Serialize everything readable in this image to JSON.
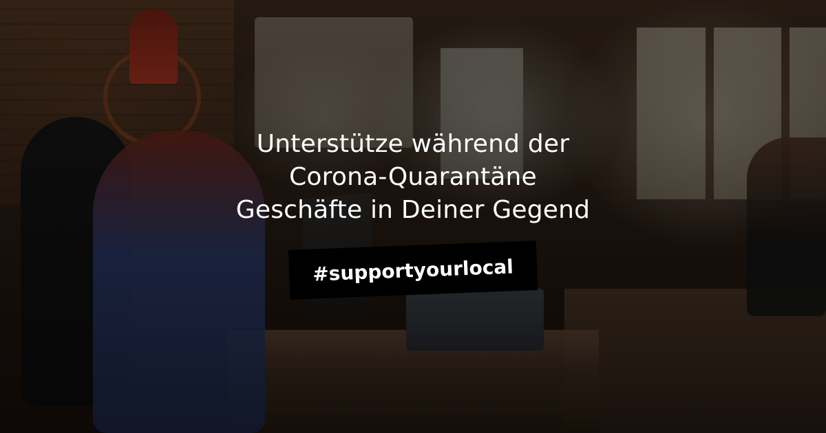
{
  "headline": {
    "lines": [
      "Unterstütze während der",
      "Corona-Quarantäne",
      "Geschäfte in Deiner Gegend"
    ],
    "color": "#ffffff"
  },
  "hashtag": {
    "text": "#supportyourlocal",
    "background": "#000000",
    "color": "#ffffff"
  }
}
